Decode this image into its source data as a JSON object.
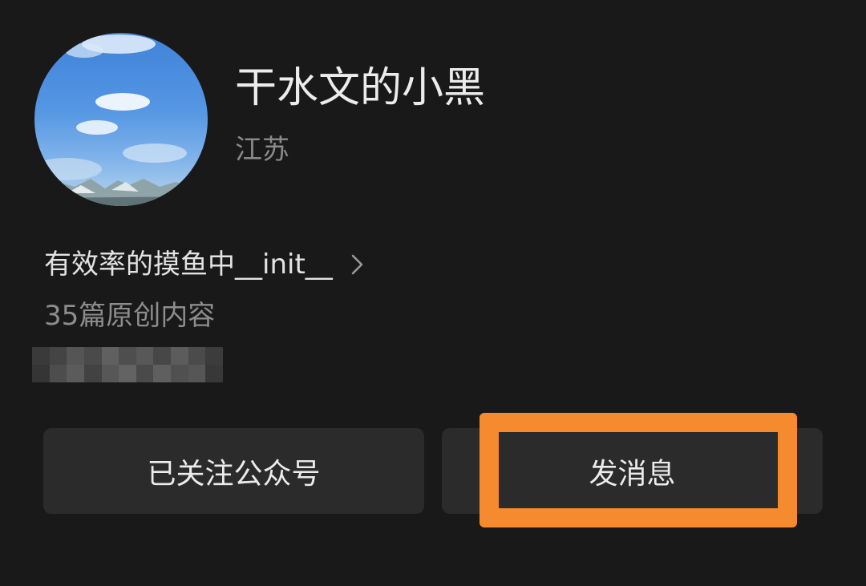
{
  "profile": {
    "name": "干水文的小黑",
    "region": "江苏",
    "signature": "有效率的摸鱼中__init__",
    "original_count": "35篇原创内容",
    "avatar_icon": "sky-landscape-avatar"
  },
  "actions": {
    "follow_label": "已关注公众号",
    "message_label": "发消息"
  },
  "colors": {
    "background": "#191919",
    "button_bg": "#2b2b2b",
    "highlight": "#f58a2e"
  },
  "icons": {
    "signature_chevron": "chevron-right-icon"
  }
}
